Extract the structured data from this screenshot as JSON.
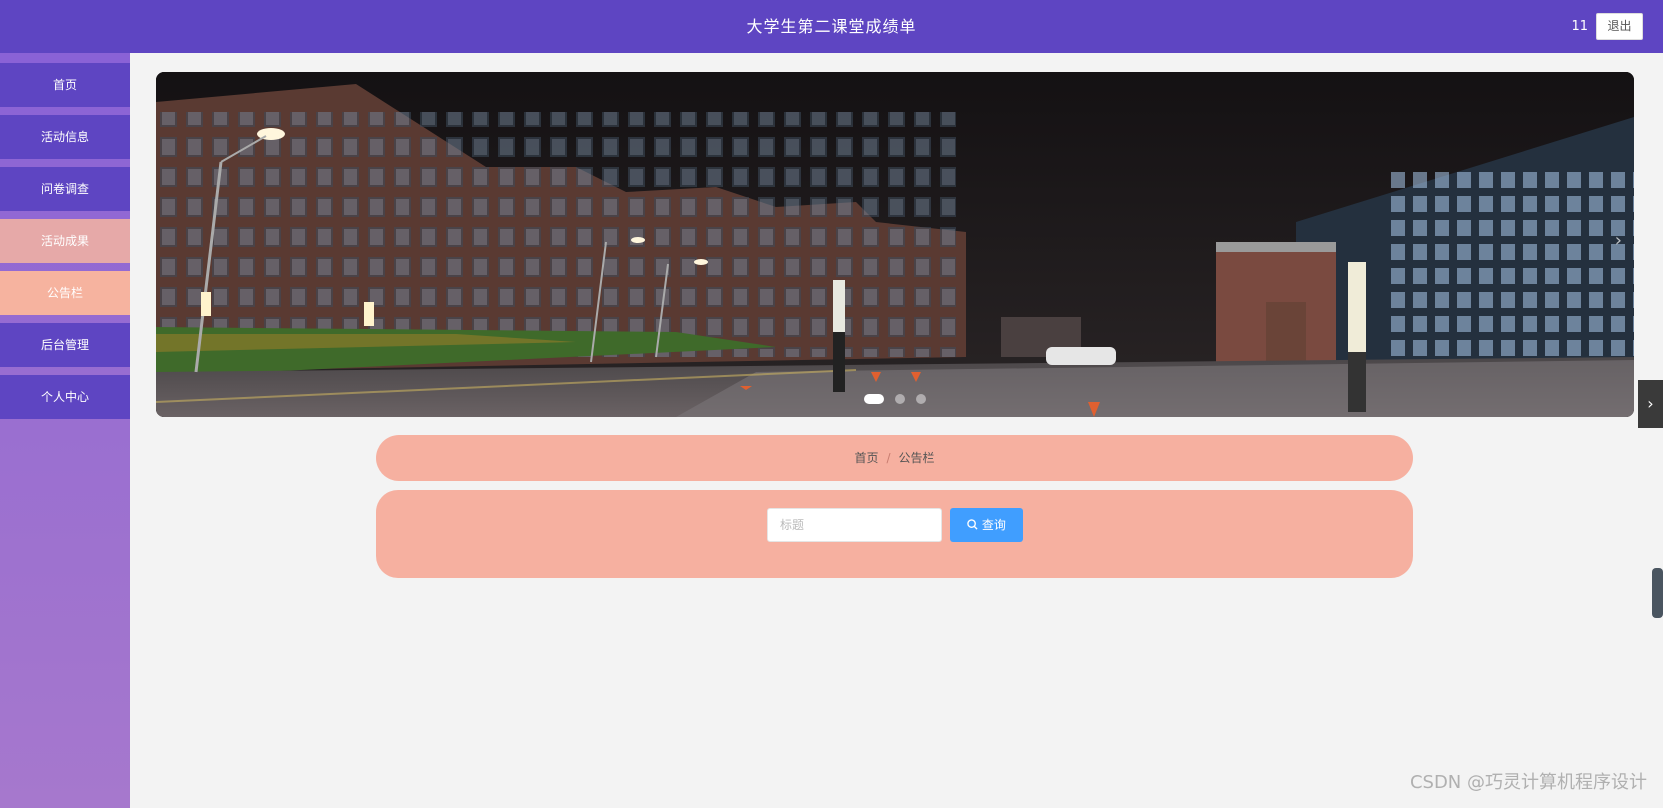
{
  "header": {
    "title": "大学生第二课堂成绩单",
    "user": "11",
    "logout_label": "退出"
  },
  "sidebar": {
    "items": [
      {
        "label": "首页",
        "state": "normal"
      },
      {
        "label": "活动信息",
        "state": "normal"
      },
      {
        "label": "问卷调查",
        "state": "normal"
      },
      {
        "label": "活动成果",
        "state": "muted"
      },
      {
        "label": "公告栏",
        "state": "active"
      },
      {
        "label": "后台管理",
        "state": "normal"
      },
      {
        "label": "个人中心",
        "state": "normal"
      }
    ]
  },
  "carousel": {
    "slide_count": 3,
    "active_index": 0
  },
  "breadcrumb": {
    "home": "首页",
    "current": "公告栏"
  },
  "search": {
    "placeholder": "标题",
    "value": "",
    "button_label": "查询"
  },
  "watermark": "CSDN @巧灵计算机程序设计",
  "colors": {
    "header": "#5e45c2",
    "sidebar_item": "#5e45c2",
    "sidebar_active": "#f6b39f",
    "panel": "#f6b0a0",
    "button": "#409eff"
  },
  "icons": {
    "search": "search-icon",
    "carousel_next": "chevron-right-icon",
    "side_tab": "chevron-right-icon"
  }
}
